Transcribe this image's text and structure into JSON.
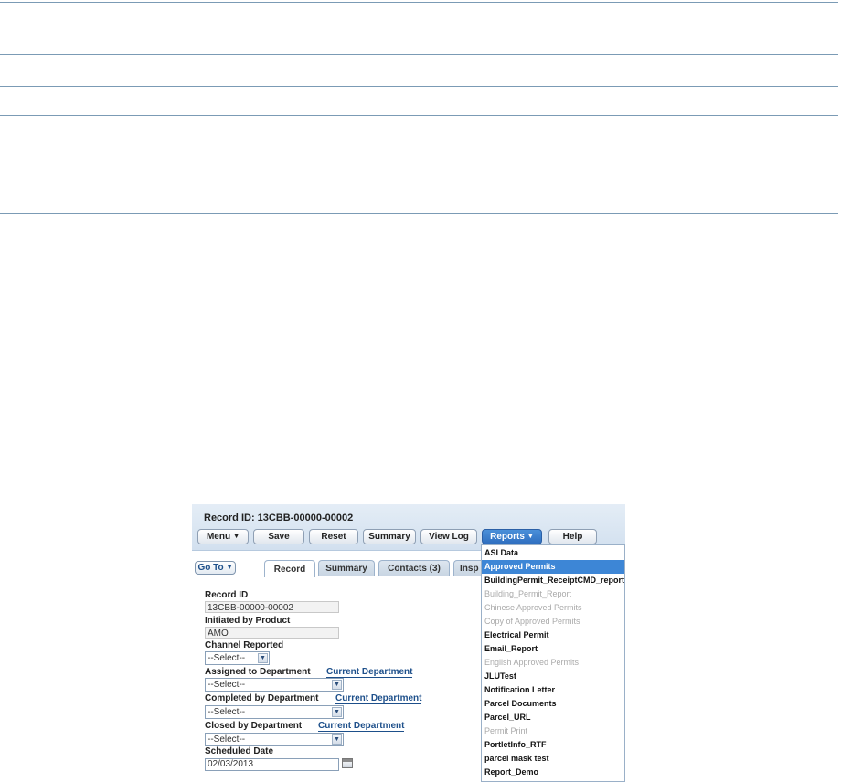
{
  "record_header": {
    "title": "Record ID: 13CBB-00000-00002"
  },
  "toolbar": {
    "menu": "Menu",
    "save": "Save",
    "reset": "Reset",
    "summary": "Summary",
    "view_log": "View Log",
    "reports": "Reports",
    "help": "Help"
  },
  "goto": "Go To",
  "tabs": [
    "Record",
    "Summary",
    "Contacts (3)",
    "Insp"
  ],
  "form": {
    "record_id_label": "Record ID",
    "record_id_value": "13CBB-00000-00002",
    "initiated_label": "Initiated by Product",
    "initiated_value": "AMO",
    "channel_label": "Channel Reported",
    "channel_value": "--Select--",
    "assigned_label": "Assigned to Department",
    "assigned_value": "--Select--",
    "completed_label": "Completed by Department",
    "completed_value": "--Select--",
    "closed_label": "Closed by Department",
    "closed_value": "--Select--",
    "current_department_link": "Current Department",
    "scheduled_label": "Scheduled Date",
    "scheduled_value": "02/03/2013"
  },
  "reports_menu": [
    {
      "label": "ASI Data",
      "state": "enabled"
    },
    {
      "label": "Approved Permits",
      "state": "highlighted"
    },
    {
      "label": "BuildingPermit_ReceiptCMD_report",
      "state": "enabled"
    },
    {
      "label": "Building_Permit_Report",
      "state": "disabled"
    },
    {
      "label": "Chinese Approved Permits",
      "state": "disabled"
    },
    {
      "label": "Copy of Approved Permits",
      "state": "disabled"
    },
    {
      "label": "Electrical Permit",
      "state": "enabled"
    },
    {
      "label": "Email_Report",
      "state": "enabled"
    },
    {
      "label": "English Approved Permits",
      "state": "disabled"
    },
    {
      "label": "JLUTest",
      "state": "enabled"
    },
    {
      "label": "Notification Letter",
      "state": "enabled"
    },
    {
      "label": "Parcel Documents",
      "state": "enabled"
    },
    {
      "label": "Parcel_URL",
      "state": "enabled"
    },
    {
      "label": "Permit Print",
      "state": "disabled"
    },
    {
      "label": "PortletInfo_RTF",
      "state": "enabled"
    },
    {
      "label": "parcel mask test",
      "state": "enabled"
    },
    {
      "label": "Report_Demo",
      "state": "enabled"
    }
  ],
  "icons": {
    "dropdown_caret": "chevron-down-icon",
    "calendar": "calendar-icon"
  },
  "colors": {
    "highlight": "#3d86d6",
    "link": "#1d4f8a",
    "rule": "#7b9bb5"
  }
}
